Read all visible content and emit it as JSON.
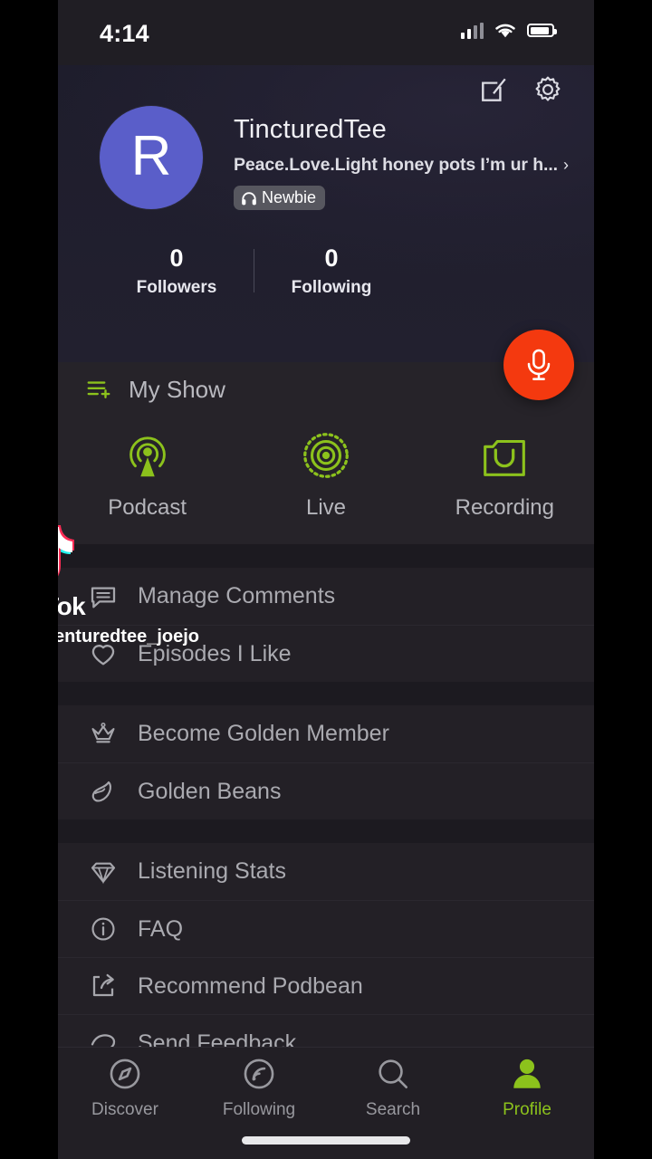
{
  "status_bar": {
    "time": "4:14",
    "icons": [
      "cellular-signal-icon",
      "wifi-icon",
      "battery-icon"
    ]
  },
  "header": {
    "edit_icon": "edit-pencil-icon",
    "settings_icon": "gear-icon",
    "avatar_letter": "R",
    "avatar_color": "#5a5ec9",
    "display_name": "TincturedTee",
    "bio": "Peace.Love.Light honey pots I’m ur h...",
    "bio_chevron": "›",
    "badge": {
      "icon": "headphones-icon",
      "label": "Newbie"
    },
    "stats": [
      {
        "value": "0",
        "label": "Followers"
      },
      {
        "value": "0",
        "label": "Following"
      }
    ],
    "record_button": {
      "icon": "microphone-icon",
      "color": "#f4390f"
    }
  },
  "my_show": {
    "icon": "playlist-add-icon",
    "title": "My Show",
    "accent_color": "#8cc21c",
    "shortcuts": [
      {
        "icon": "podcast-broadcast-icon",
        "label": "Podcast"
      },
      {
        "icon": "live-radio-icon",
        "label": "Live"
      },
      {
        "icon": "recording-icon",
        "label": "Recording"
      }
    ]
  },
  "menu_sections": [
    {
      "items": [
        {
          "icon": "comment-icon",
          "label": "Manage Comments"
        },
        {
          "icon": "heart-icon",
          "label": "Episodes I Like"
        }
      ]
    },
    {
      "items": [
        {
          "icon": "crown-icon",
          "label": "Become Golden Member"
        },
        {
          "icon": "bean-icon",
          "label": "Golden Beans"
        }
      ]
    },
    {
      "items": [
        {
          "icon": "diamond-icon",
          "label": "Listening Stats"
        },
        {
          "icon": "info-icon",
          "label": "FAQ"
        },
        {
          "icon": "share-icon",
          "label": "Recommend Podbean"
        },
        {
          "icon": "feedback-icon",
          "label": "Send Feedback"
        }
      ]
    }
  ],
  "tab_bar": {
    "active_color": "#8cc21c",
    "tabs": [
      {
        "icon": "compass-icon",
        "label": "Discover",
        "active": false
      },
      {
        "icon": "rss-icon",
        "label": "Following",
        "active": false
      },
      {
        "icon": "search-icon",
        "label": "Search",
        "active": false
      },
      {
        "icon": "person-icon",
        "label": "Profile",
        "active": true
      }
    ]
  },
  "watermark": {
    "logo": "tiktok-logo-icon",
    "wordmark": "TikTok",
    "user_icon": "person-small-icon",
    "username": "@tenturedtee_joejo"
  }
}
